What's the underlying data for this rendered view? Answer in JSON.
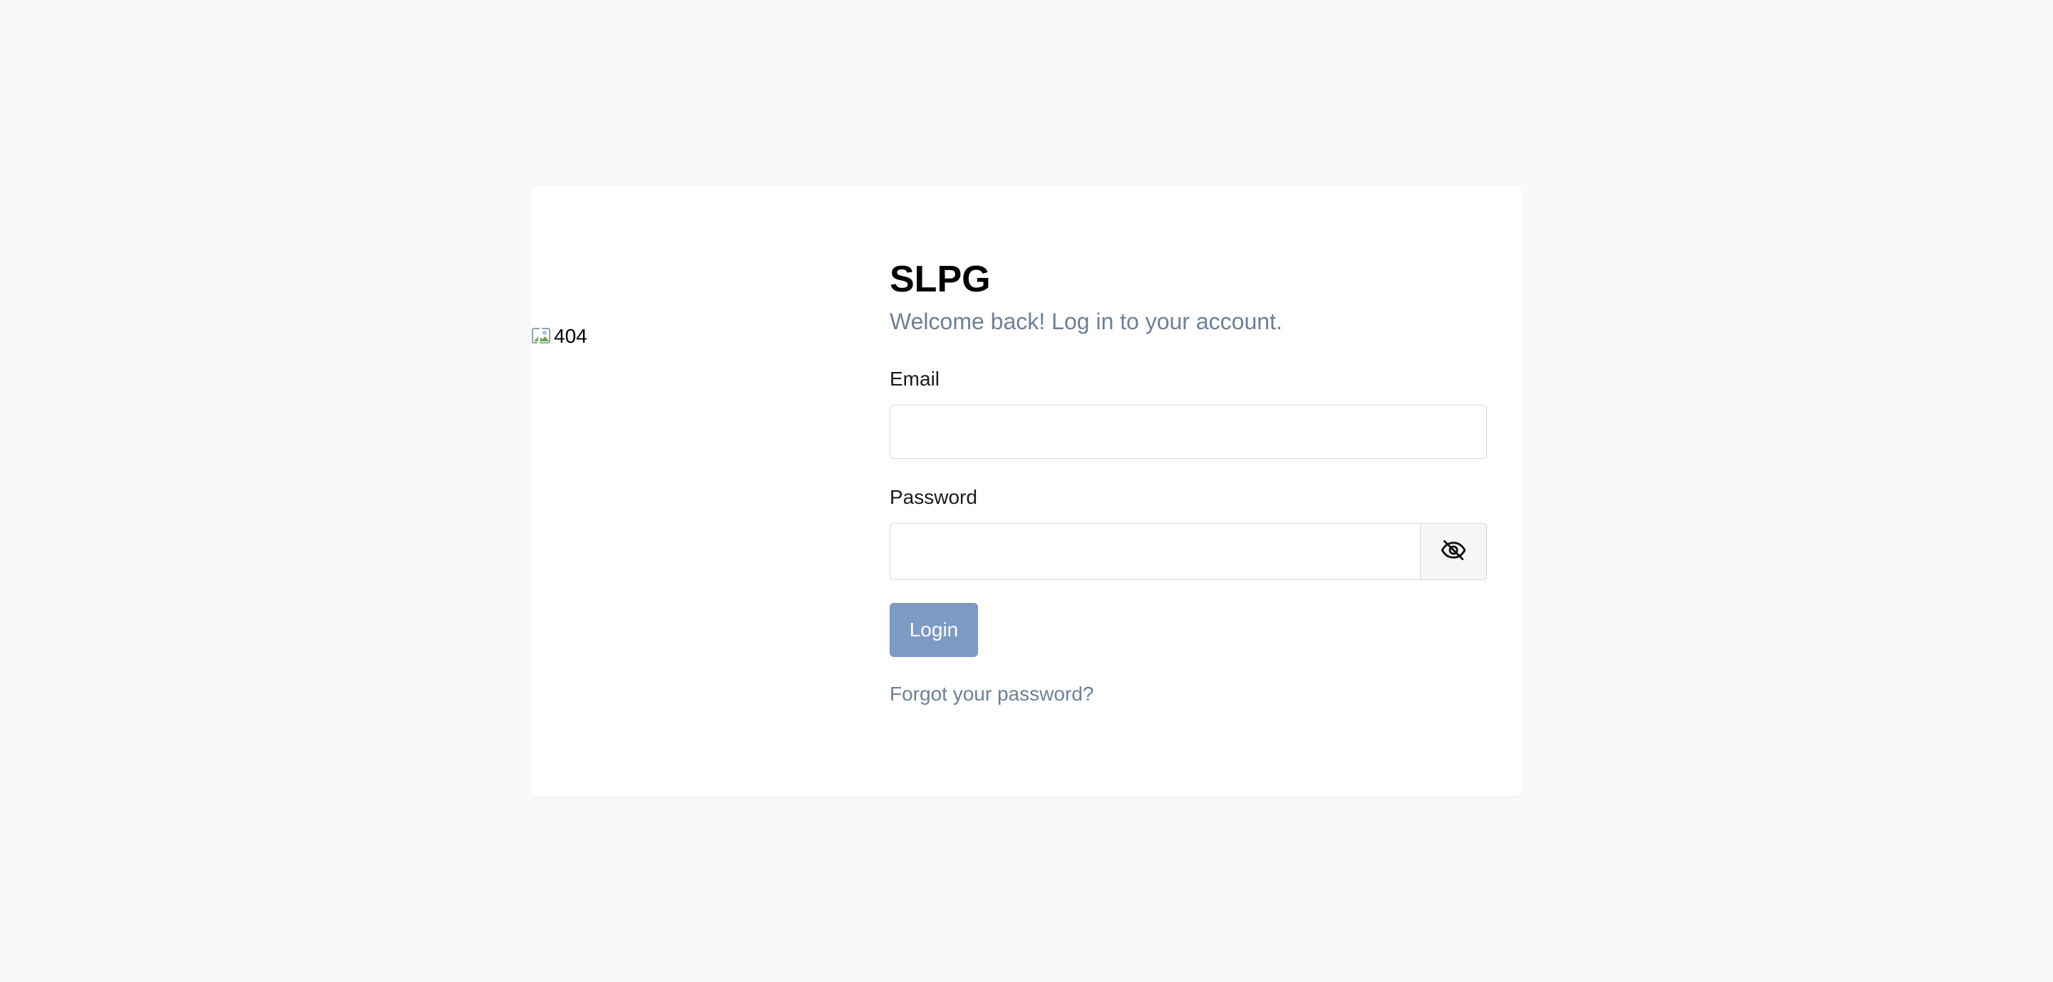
{
  "brand": {
    "name": "SLPG"
  },
  "hero_image": {
    "alt_text": "404"
  },
  "login": {
    "subtitle": "Welcome back! Log in to your account.",
    "email_label": "Email",
    "email_value": "",
    "password_label": "Password",
    "password_value": "",
    "toggle_icon": "eye-off-icon",
    "submit_label": "Login",
    "forgot_link": "Forgot your password?"
  },
  "colors": {
    "page_background": "#f8f9fa",
    "card_background": "#ffffff",
    "accent_button": "#7d9ac4",
    "muted_text": "#6e7f99"
  }
}
